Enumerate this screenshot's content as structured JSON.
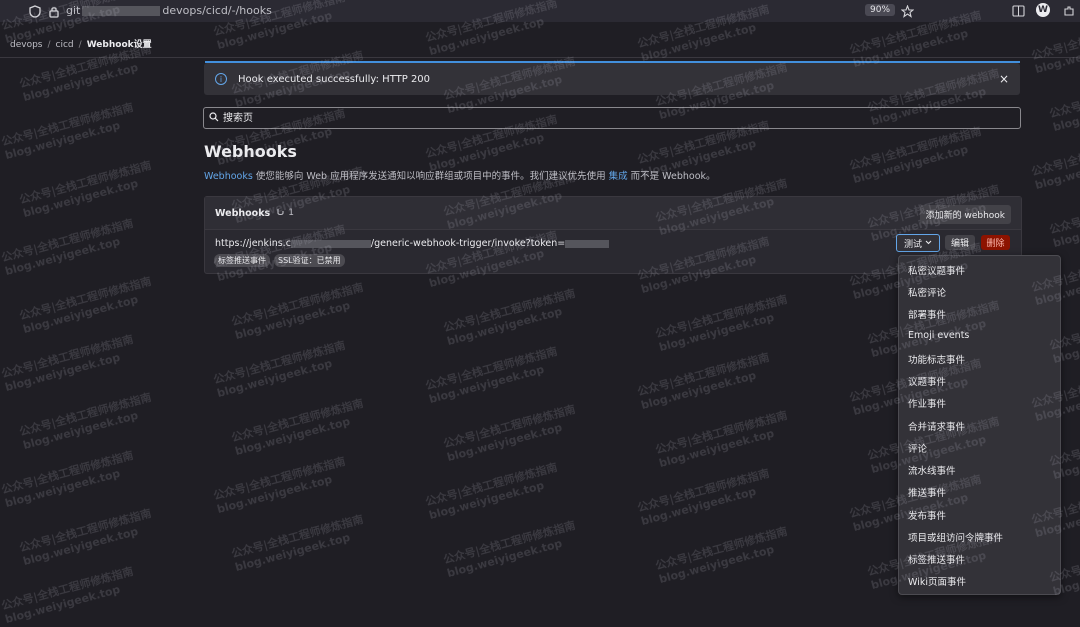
{
  "browser": {
    "url_prefix": "git",
    "url_suffix": "devops/cicd/-/hooks",
    "zoom": "90%",
    "profile_initial": "W"
  },
  "breadcrumb": [
    "devops",
    "cicd",
    "Webhook设置"
  ],
  "alert": {
    "message": "Hook executed successfully: HTTP 200",
    "close": "×"
  },
  "search": {
    "placeholder": "搜索页"
  },
  "page": {
    "title": "Webhooks",
    "desc_link": "Webhooks",
    "desc_mid": " 使您能够向 Web 应用程序发送通知以响应群组或项目中的事件。我们建议优先使用 ",
    "desc_link2": "集成",
    "desc_end": " 而不是 Webhook。"
  },
  "card": {
    "title": "Webhooks",
    "count": "1",
    "add_button": "添加新的 webhook",
    "hook_url_prefix": "https://jenkins.c",
    "hook_url_mid": "generic-webhook-trigger/invoke?token=",
    "tags": [
      "标签推送事件",
      "SSL验证：已禁用"
    ],
    "test_button": "测试",
    "edit_button": "编辑",
    "delete_button": "删除"
  },
  "dropdown": {
    "items": [
      "私密议题事件",
      "私密评论",
      "部署事件",
      "Emoji events",
      "功能标志事件",
      "议题事件",
      "作业事件",
      "合并请求事件",
      "评论",
      "流水线事件",
      "推送事件",
      "发布事件",
      "项目或组访问令牌事件",
      "标签推送事件",
      "Wiki页面事件"
    ]
  },
  "watermark": {
    "line1": "公众号|全栈工程师修炼指南",
    "line2": "blog.weiyigeek.top"
  }
}
